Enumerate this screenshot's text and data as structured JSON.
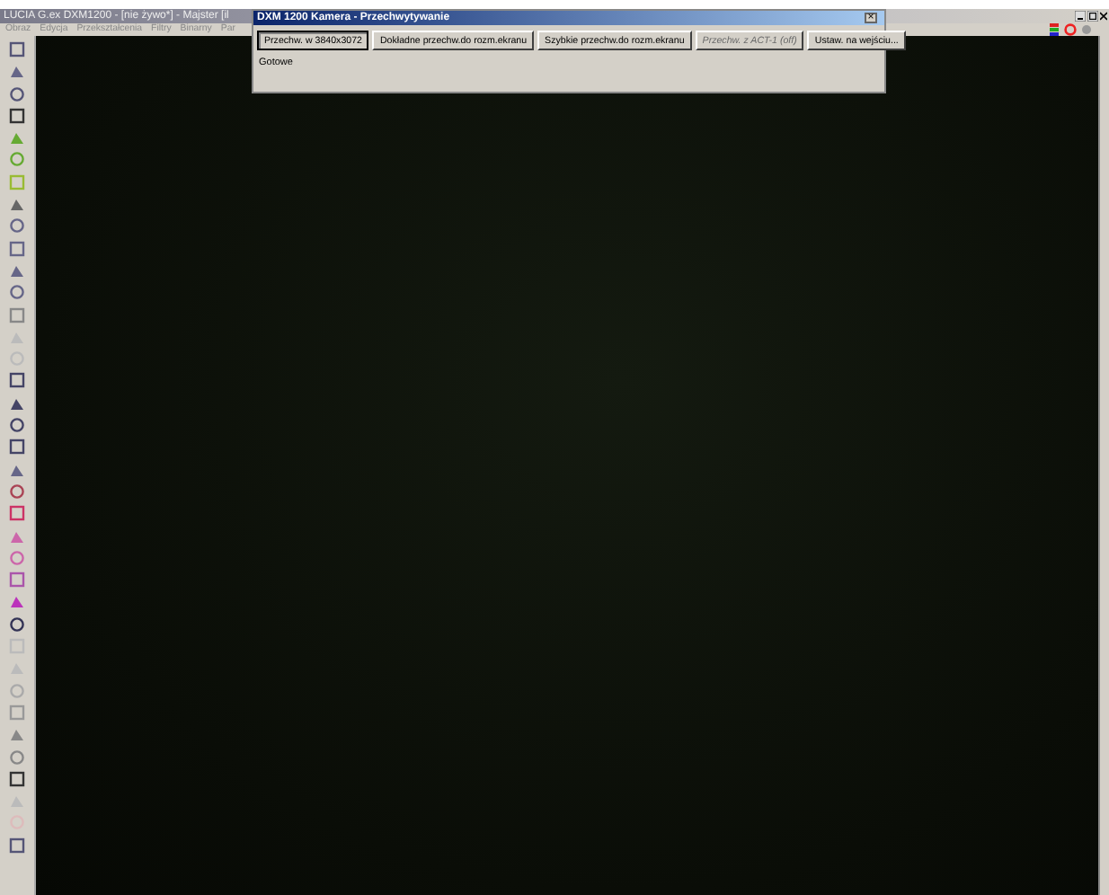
{
  "window": {
    "title": "LUCIA G.ex DXM1200 - [nie żywo*] - Majster [il"
  },
  "menu": [
    {
      "label": "Obraz"
    },
    {
      "label": "Edycja"
    },
    {
      "label": "Przekształcenia"
    },
    {
      "label": "Filtry"
    },
    {
      "label": "Binarny"
    },
    {
      "label": "Par"
    }
  ],
  "dialog": {
    "title": "DXM 1200 Kamera - Przechwytywanie",
    "close": "×",
    "buttons": [
      {
        "label": "Przechw. w 3840x3072",
        "disabled": false,
        "selected": true
      },
      {
        "label": "Dokładne przechw.do rozm.ekranu",
        "disabled": false,
        "selected": false
      },
      {
        "label": "Szybkie przechw.do rozm.ekranu",
        "disabled": false,
        "selected": false
      },
      {
        "label": "Przechw. z ACT-1 (off)",
        "disabled": true,
        "selected": false
      },
      {
        "label": "Ustaw. na wejściu...",
        "disabled": false,
        "selected": false
      }
    ],
    "status": "Gotowe"
  }
}
